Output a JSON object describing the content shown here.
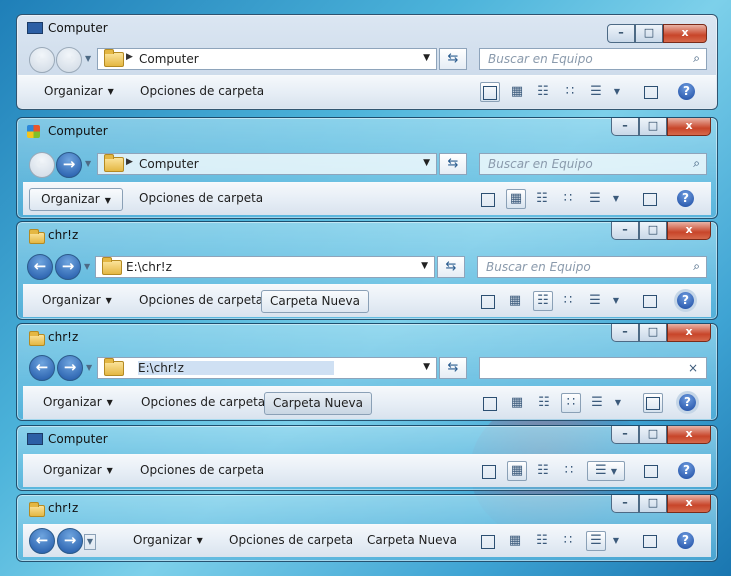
{
  "windows": [
    {
      "title": "Computer",
      "icon": "computer-icon",
      "path": "Computer",
      "search_placeholder": "Buscar en Equipo",
      "toolbar": {
        "organize": "Organizar",
        "folder_options": "Opciones de carpeta"
      }
    },
    {
      "title": "Computer",
      "icon": "windows-logo-icon",
      "path": "Computer",
      "search_placeholder": "Buscar en Equipo",
      "toolbar": {
        "organize": "Organizar",
        "folder_options": "Opciones de carpeta"
      }
    },
    {
      "title": "chr!z",
      "icon": "folder-icon",
      "path": "E:\\chr!z",
      "search_placeholder": "Buscar en Equipo",
      "toolbar": {
        "organize": "Organizar",
        "folder_options": "Opciones de carpeta",
        "new_folder": "Carpeta Nueva"
      }
    },
    {
      "title": "chr!z",
      "icon": "folder-icon",
      "path": "E:\\chr!z",
      "search_placeholder": "",
      "toolbar": {
        "organize": "Organizar",
        "folder_options": "Opciones de carpeta",
        "new_folder": "Carpeta Nueva"
      }
    },
    {
      "title": "Computer",
      "icon": "computer-icon",
      "toolbar": {
        "organize": "Organizar",
        "folder_options": "Opciones de carpeta"
      }
    },
    {
      "title": "chr!z",
      "icon": "folder-icon",
      "toolbar": {
        "organize": "Organizar",
        "folder_options": "Opciones de carpeta",
        "new_folder": "Carpeta Nueva"
      }
    }
  ],
  "glyphs": {
    "back": "←",
    "forward": "→",
    "help": "?",
    "search": "⌕",
    "refresh": "⇆",
    "clear": "×",
    "min": "–",
    "max": "□",
    "close": "x"
  }
}
